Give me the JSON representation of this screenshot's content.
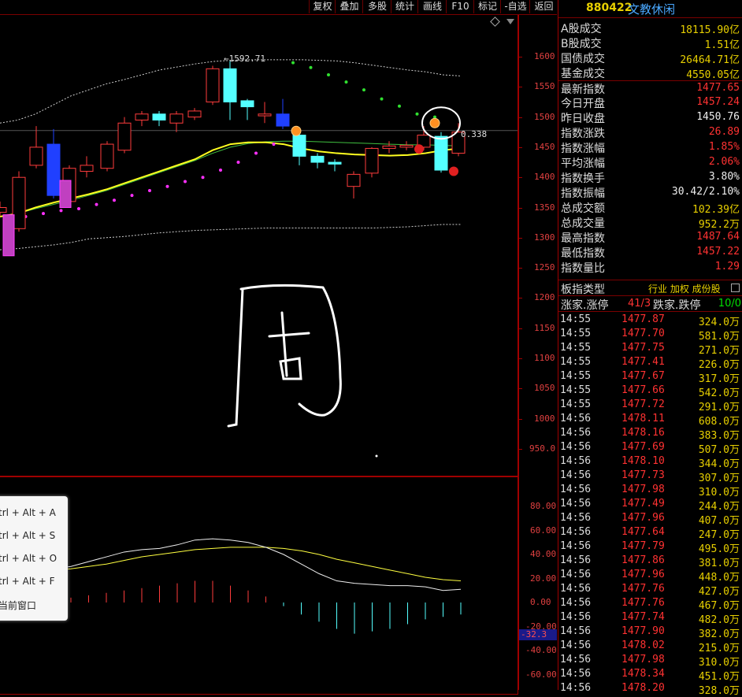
{
  "toolbar": {
    "buttons": [
      "复权",
      "叠加",
      "多股",
      "统计",
      "画线",
      "F10",
      "标记",
      "-自选",
      "返回"
    ]
  },
  "main_chart": {
    "y_ticks": [
      "1600",
      "1550",
      "1500",
      "1450",
      "1400",
      "1350",
      "1300",
      "1250",
      "1200",
      "1150",
      "1100",
      "1050",
      "1000",
      "950.0"
    ],
    "high_label": "1592.71",
    "last_label": "0.338",
    "handwriting_char": "周"
  },
  "chart_data": [
    {
      "type": "candlestick",
      "y_ticks": [
        1600,
        1550,
        1500,
        1450,
        1400,
        1350,
        1300,
        1250,
        1200,
        1150,
        1100,
        1050,
        1000,
        950
      ],
      "annotations": [
        "1592.71"
      ],
      "candles": [
        {
          "o": 1350,
          "c": 1342,
          "h": 1360,
          "l": 1335,
          "color": "red"
        },
        {
          "o": 1315,
          "c": 1400,
          "h": 1410,
          "l": 1310,
          "color": "red"
        },
        {
          "o": 1420,
          "c": 1450,
          "h": 1485,
          "l": 1415,
          "color": "red"
        },
        {
          "o": 1455,
          "c": 1370,
          "h": 1480,
          "l": 1365,
          "color": "blue"
        },
        {
          "o": 1360,
          "c": 1415,
          "h": 1420,
          "l": 1350,
          "color": "red"
        },
        {
          "o": 1410,
          "c": 1420,
          "h": 1435,
          "l": 1400,
          "color": "red"
        },
        {
          "o": 1415,
          "c": 1455,
          "h": 1460,
          "l": 1410,
          "color": "red"
        },
        {
          "o": 1445,
          "c": 1490,
          "h": 1500,
          "l": 1440,
          "color": "red"
        },
        {
          "o": 1495,
          "c": 1505,
          "h": 1510,
          "l": 1485,
          "color": "red"
        },
        {
          "o": 1505,
          "c": 1495,
          "h": 1510,
          "l": 1485,
          "color": "cyan"
        },
        {
          "o": 1490,
          "c": 1505,
          "h": 1510,
          "l": 1475,
          "color": "red"
        },
        {
          "o": 1500,
          "c": 1510,
          "h": 1515,
          "l": 1495,
          "color": "red"
        },
        {
          "o": 1525,
          "c": 1580,
          "h": 1585,
          "l": 1520,
          "color": "red"
        },
        {
          "o": 1580,
          "c": 1525,
          "h": 1593,
          "l": 1495,
          "color": "cyan"
        },
        {
          "o": 1527,
          "c": 1517,
          "h": 1530,
          "l": 1495,
          "color": "cyan"
        },
        {
          "o": 1505,
          "c": 1502,
          "h": 1525,
          "l": 1490,
          "color": "red"
        },
        {
          "o": 1505,
          "c": 1485,
          "h": 1530,
          "l": 1480,
          "color": "blue"
        },
        {
          "o": 1470,
          "c": 1435,
          "h": 1475,
          "l": 1420,
          "color": "cyan"
        },
        {
          "o": 1435,
          "c": 1425,
          "h": 1440,
          "l": 1415,
          "color": "cyan"
        },
        {
          "o": 1425,
          "c": 1422,
          "h": 1430,
          "l": 1410,
          "color": "cyan"
        },
        {
          "o": 1385,
          "c": 1405,
          "h": 1410,
          "l": 1365,
          "color": "red"
        },
        {
          "o": 1407,
          "c": 1448,
          "h": 1450,
          "l": 1400,
          "color": "red"
        },
        {
          "o": 1448,
          "c": 1452,
          "h": 1460,
          "l": 1440,
          "color": "red"
        },
        {
          "o": 1450,
          "c": 1453,
          "h": 1460,
          "l": 1445,
          "color": "red"
        },
        {
          "o": 1450,
          "c": 1470,
          "h": 1485,
          "l": 1445,
          "color": "red"
        },
        {
          "o": 1468,
          "c": 1412,
          "h": 1475,
          "l": 1408,
          "color": "cyan"
        },
        {
          "o": 1440,
          "c": 1475,
          "h": 1490,
          "l": 1435,
          "color": "red"
        }
      ]
    },
    {
      "type": "line",
      "y_ticks": [
        80,
        60,
        40,
        20,
        0,
        -20,
        -40,
        -60
      ],
      "current_value_label": "-32.3"
    }
  ],
  "macd": {
    "y_ticks": [
      "80.00",
      "60.00",
      "40.00",
      "20.00",
      "0.00",
      "-20.00",
      "-40.00",
      "-60.00"
    ],
    "current_label": "-32.3"
  },
  "popup": {
    "items": [
      "trl + Alt + A",
      "trl + Alt + S",
      "trl + Alt + O",
      "trl + Alt + F",
      "当前窗口"
    ]
  },
  "panel": {
    "code": "880422",
    "name": "文教休闲",
    "rows": [
      {
        "label": "A股成交",
        "value": "18115.90",
        "unit": "亿",
        "color": "yellow"
      },
      {
        "label": "B股成交",
        "value": "1.51",
        "unit": "亿",
        "color": "yellow"
      },
      {
        "label": "国债成交",
        "value": "26464.71",
        "unit": "亿",
        "color": "yellow"
      },
      {
        "label": "基金成交",
        "value": "4550.05",
        "unit": "亿",
        "color": "yellow"
      },
      {
        "label": "最新指数",
        "value": "1477.65",
        "unit": "",
        "color": "red"
      },
      {
        "label": "今日开盘",
        "value": "1457.24",
        "unit": "",
        "color": "red"
      },
      {
        "label": "昨日收盘",
        "value": "1450.76",
        "unit": "",
        "color": "white"
      },
      {
        "label": "指数涨跌",
        "value": "26.89",
        "unit": "",
        "color": "red"
      },
      {
        "label": "指数涨幅",
        "value": "1.85%",
        "unit": "",
        "color": "red"
      },
      {
        "label": "平均涨幅",
        "value": "2.06%",
        "unit": "",
        "color": "red"
      },
      {
        "label": "指数换手",
        "value": "3.80%",
        "unit": "",
        "color": "white"
      },
      {
        "label": "指数振幅",
        "value": "30.42/2.10%",
        "unit": "",
        "color": "white"
      },
      {
        "label": "总成交额",
        "value": "102.39",
        "unit": "亿",
        "color": "yellow"
      },
      {
        "label": "总成交量",
        "value": "952.2",
        "unit": "万",
        "color": "yellow"
      },
      {
        "label": "最高指数",
        "value": "1487.64",
        "unit": "",
        "color": "red"
      },
      {
        "label": "最低指数",
        "value": "1457.22",
        "unit": "",
        "color": "red"
      },
      {
        "label": "指数量比",
        "value": "1.29",
        "unit": "",
        "color": "red"
      }
    ],
    "board_type_label": "板指类型",
    "board_type_value": "行业 加权 成份股",
    "updown_label": "涨家.涨停",
    "updown_value": "41/3",
    "down_label": "跌家.跌停",
    "down_value": "10/0",
    "ticks": [
      {
        "t": "14:55",
        "p": "1477.87",
        "v": "324.0"
      },
      {
        "t": "14:55",
        "p": "1477.70",
        "v": "581.0"
      },
      {
        "t": "14:55",
        "p": "1477.75",
        "v": "271.0"
      },
      {
        "t": "14:55",
        "p": "1477.41",
        "v": "226.0"
      },
      {
        "t": "14:55",
        "p": "1477.67",
        "v": "317.0"
      },
      {
        "t": "14:55",
        "p": "1477.66",
        "v": "542.0"
      },
      {
        "t": "14:55",
        "p": "1477.72",
        "v": "291.0"
      },
      {
        "t": "14:56",
        "p": "1478.11",
        "v": "608.0"
      },
      {
        "t": "14:56",
        "p": "1478.16",
        "v": "383.0"
      },
      {
        "t": "14:56",
        "p": "1477.69",
        "v": "507.0"
      },
      {
        "t": "14:56",
        "p": "1478.10",
        "v": "344.0"
      },
      {
        "t": "14:56",
        "p": "1477.73",
        "v": "307.0"
      },
      {
        "t": "14:56",
        "p": "1477.98",
        "v": "310.0"
      },
      {
        "t": "14:56",
        "p": "1477.49",
        "v": "244.0"
      },
      {
        "t": "14:56",
        "p": "1477.96",
        "v": "407.0"
      },
      {
        "t": "14:56",
        "p": "1477.64",
        "v": "247.0"
      },
      {
        "t": "14:56",
        "p": "1477.79",
        "v": "495.0"
      },
      {
        "t": "14:56",
        "p": "1477.86",
        "v": "381.0"
      },
      {
        "t": "14:56",
        "p": "1477.96",
        "v": "448.0"
      },
      {
        "t": "14:56",
        "p": "1477.76",
        "v": "427.0"
      },
      {
        "t": "14:56",
        "p": "1477.76",
        "v": "467.0"
      },
      {
        "t": "14:56",
        "p": "1477.74",
        "v": "482.0"
      },
      {
        "t": "14:56",
        "p": "1477.90",
        "v": "382.0"
      },
      {
        "t": "14:56",
        "p": "1478.02",
        "v": "215.0"
      },
      {
        "t": "14:56",
        "p": "1477.98",
        "v": "310.0"
      },
      {
        "t": "14:56",
        "p": "1478.34",
        "v": "451.0"
      },
      {
        "t": "14:56",
        "p": "1478.20",
        "v": "328.0"
      }
    ],
    "tick_unit": "万"
  }
}
